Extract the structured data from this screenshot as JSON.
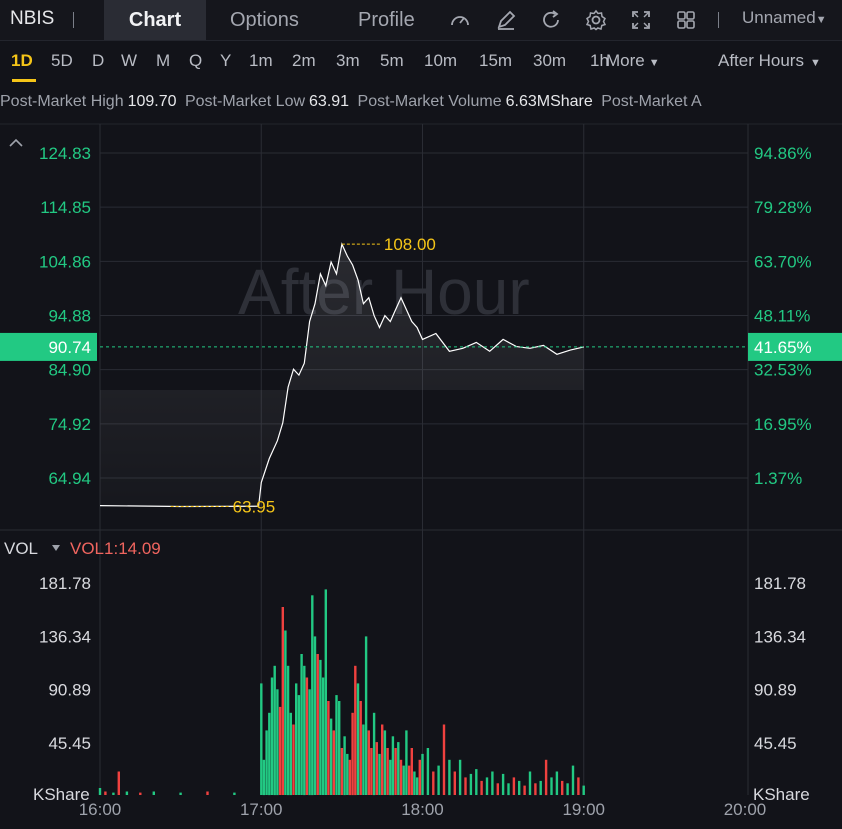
{
  "header": {
    "ticker": "NBIS",
    "tabs": [
      "Chart",
      "Options",
      "Profile"
    ],
    "active_tab": "Chart",
    "icons": [
      "speedometer-icon",
      "draw-icon",
      "refresh-icon",
      "settings-icon",
      "fullscreen-icon",
      "layout-grid-icon"
    ],
    "layout_name": "Unnamed"
  },
  "timeframes": {
    "items": [
      "1D",
      "5D",
      "D",
      "W",
      "M",
      "Q",
      "Y",
      "1m",
      "2m",
      "3m",
      "5m",
      "10m",
      "15m",
      "30m",
      "1h"
    ],
    "active": "1D",
    "more_label": "More",
    "session_label": "After Hours"
  },
  "info": {
    "high_label": "Post-Market High",
    "high_value": "109.70",
    "low_label": "Post-Market Low",
    "low_value": "63.91",
    "volume_label": "Post-Market Volume",
    "volume_value": "6.63MShare",
    "truncated_label": "Post-Market A"
  },
  "price_chart": {
    "watermark": "After Hour",
    "left_axis": [
      "124.83",
      "114.85",
      "104.86",
      "94.88",
      "84.90",
      "74.92",
      "64.94"
    ],
    "right_axis": [
      "94.86%",
      "79.28%",
      "63.70%",
      "48.11%",
      "32.53%",
      "16.95%",
      "1.37%"
    ],
    "current_price": "90.74",
    "current_pct": "41.65%",
    "high_marker": "108.00",
    "low_marker": "63.95",
    "colors": {
      "up": "#22c983",
      "down": "#f0413f",
      "marker": "#f5c518",
      "line": "#ffffff"
    }
  },
  "volume_panel": {
    "label": "VOL",
    "indicator": "VOL1:14.09",
    "axis": [
      "181.78",
      "136.34",
      "90.89",
      "45.45"
    ],
    "unit": "KShare"
  },
  "x_axis": [
    "16:00",
    "17:00",
    "18:00",
    "19:00",
    "20:00"
  ],
  "chart_data": {
    "type": "line",
    "x_range": [
      "16:00",
      "20:00"
    ],
    "price_ylim": [
      60,
      128
    ],
    "price_series": [
      [
        "16:00",
        64.1
      ],
      [
        "16:30",
        63.95
      ],
      [
        "16:59",
        64.0
      ],
      [
        "17:00",
        68
      ],
      [
        "17:03",
        72
      ],
      [
        "17:06",
        75
      ],
      [
        "17:08",
        78
      ],
      [
        "17:10",
        84
      ],
      [
        "17:12",
        87
      ],
      [
        "17:14",
        86
      ],
      [
        "17:16",
        88
      ],
      [
        "17:18",
        95
      ],
      [
        "17:20",
        98
      ],
      [
        "17:22",
        103
      ],
      [
        "17:24",
        101
      ],
      [
        "17:26",
        105
      ],
      [
        "17:28",
        103
      ],
      [
        "17:30",
        108
      ],
      [
        "17:32",
        106
      ],
      [
        "17:34",
        104.5
      ],
      [
        "17:36",
        102
      ],
      [
        "17:38",
        98
      ],
      [
        "17:40",
        99
      ],
      [
        "17:42",
        96
      ],
      [
        "17:44",
        94
      ],
      [
        "17:46",
        96
      ],
      [
        "17:48",
        95
      ],
      [
        "17:50",
        97
      ],
      [
        "17:52",
        99
      ],
      [
        "17:54",
        97
      ],
      [
        "17:56",
        95
      ],
      [
        "17:58",
        94
      ],
      [
        "18:00",
        92
      ],
      [
        "18:05",
        93
      ],
      [
        "18:10",
        90
      ],
      [
        "18:15",
        90.5
      ],
      [
        "18:20",
        91.5
      ],
      [
        "18:25",
        90
      ],
      [
        "18:30",
        92
      ],
      [
        "18:35",
        90.8
      ],
      [
        "18:40",
        90.5
      ],
      [
        "18:45",
        91
      ],
      [
        "18:50",
        89.5
      ],
      [
        "18:55",
        90.2
      ],
      [
        "19:00",
        90.74
      ]
    ],
    "volume_ylim": [
      0,
      200
    ],
    "volume_series": [
      [
        "16:00",
        6,
        "up"
      ],
      [
        "16:02",
        3,
        "down"
      ],
      [
        "16:05",
        2,
        "up"
      ],
      [
        "16:07",
        20,
        "down"
      ],
      [
        "16:10",
        3,
        "up"
      ],
      [
        "16:15",
        2,
        "down"
      ],
      [
        "16:20",
        3,
        "up"
      ],
      [
        "16:30",
        2,
        "up"
      ],
      [
        "16:40",
        3,
        "down"
      ],
      [
        "16:50",
        2,
        "up"
      ],
      [
        "17:00",
        95,
        "up"
      ],
      [
        "17:01",
        30,
        "up"
      ],
      [
        "17:02",
        55,
        "up"
      ],
      [
        "17:03",
        70,
        "up"
      ],
      [
        "17:04",
        100,
        "up"
      ],
      [
        "17:05",
        110,
        "up"
      ],
      [
        "17:06",
        90,
        "up"
      ],
      [
        "17:07",
        75,
        "down"
      ],
      [
        "17:08",
        160,
        "down"
      ],
      [
        "17:09",
        140,
        "up"
      ],
      [
        "17:10",
        110,
        "up"
      ],
      [
        "17:11",
        70,
        "up"
      ],
      [
        "17:12",
        60,
        "down"
      ],
      [
        "17:13",
        95,
        "up"
      ],
      [
        "17:14",
        85,
        "up"
      ],
      [
        "17:15",
        120,
        "up"
      ],
      [
        "17:16",
        110,
        "up"
      ],
      [
        "17:17",
        100,
        "down"
      ],
      [
        "17:18",
        90,
        "up"
      ],
      [
        "17:19",
        170,
        "up"
      ],
      [
        "17:20",
        135,
        "up"
      ],
      [
        "17:21",
        120,
        "down"
      ],
      [
        "17:22",
        115,
        "up"
      ],
      [
        "17:23",
        100,
        "up"
      ],
      [
        "17:24",
        175,
        "up"
      ],
      [
        "17:25",
        80,
        "down"
      ],
      [
        "17:26",
        65,
        "up"
      ],
      [
        "17:27",
        55,
        "down"
      ],
      [
        "17:28",
        85,
        "up"
      ],
      [
        "17:29",
        80,
        "up"
      ],
      [
        "17:30",
        40,
        "down"
      ],
      [
        "17:31",
        50,
        "up"
      ],
      [
        "17:32",
        35,
        "up"
      ],
      [
        "17:33",
        30,
        "down"
      ],
      [
        "17:34",
        70,
        "down"
      ],
      [
        "17:35",
        110,
        "down"
      ],
      [
        "17:36",
        95,
        "up"
      ],
      [
        "17:37",
        80,
        "down"
      ],
      [
        "17:38",
        60,
        "up"
      ],
      [
        "17:39",
        135,
        "up"
      ],
      [
        "17:40",
        55,
        "down"
      ],
      [
        "17:41",
        40,
        "down"
      ],
      [
        "17:42",
        70,
        "up"
      ],
      [
        "17:43",
        45,
        "down"
      ],
      [
        "17:44",
        35,
        "up"
      ],
      [
        "17:45",
        60,
        "down"
      ],
      [
        "17:46",
        55,
        "up"
      ],
      [
        "17:47",
        40,
        "down"
      ],
      [
        "17:48",
        30,
        "up"
      ],
      [
        "17:49",
        50,
        "up"
      ],
      [
        "17:50",
        40,
        "down"
      ],
      [
        "17:51",
        45,
        "up"
      ],
      [
        "17:52",
        30,
        "down"
      ],
      [
        "17:53",
        25,
        "up"
      ],
      [
        "17:54",
        55,
        "up"
      ],
      [
        "17:55",
        25,
        "down"
      ],
      [
        "17:56",
        40,
        "down"
      ],
      [
        "17:57",
        20,
        "up"
      ],
      [
        "17:58",
        15,
        "up"
      ],
      [
        "17:59",
        30,
        "down"
      ],
      [
        "18:00",
        35,
        "up"
      ],
      [
        "18:02",
        40,
        "up"
      ],
      [
        "18:04",
        20,
        "down"
      ],
      [
        "18:06",
        25,
        "up"
      ],
      [
        "18:08",
        60,
        "down"
      ],
      [
        "18:10",
        30,
        "up"
      ],
      [
        "18:12",
        20,
        "down"
      ],
      [
        "18:14",
        30,
        "up"
      ],
      [
        "18:16",
        15,
        "down"
      ],
      [
        "18:18",
        18,
        "up"
      ],
      [
        "18:20",
        22,
        "up"
      ],
      [
        "18:22",
        12,
        "down"
      ],
      [
        "18:24",
        15,
        "up"
      ],
      [
        "18:26",
        20,
        "up"
      ],
      [
        "18:28",
        10,
        "down"
      ],
      [
        "18:30",
        18,
        "up"
      ],
      [
        "18:32",
        10,
        "up"
      ],
      [
        "18:34",
        15,
        "down"
      ],
      [
        "18:36",
        12,
        "up"
      ],
      [
        "18:38",
        8,
        "down"
      ],
      [
        "18:40",
        20,
        "up"
      ],
      [
        "18:42",
        10,
        "down"
      ],
      [
        "18:44",
        12,
        "up"
      ],
      [
        "18:46",
        30,
        "down"
      ],
      [
        "18:48",
        15,
        "up"
      ],
      [
        "18:50",
        20,
        "up"
      ],
      [
        "18:52",
        12,
        "down"
      ],
      [
        "18:54",
        10,
        "up"
      ],
      [
        "18:56",
        25,
        "up"
      ],
      [
        "18:58",
        15,
        "down"
      ],
      [
        "19:00",
        8,
        "up"
      ]
    ]
  }
}
